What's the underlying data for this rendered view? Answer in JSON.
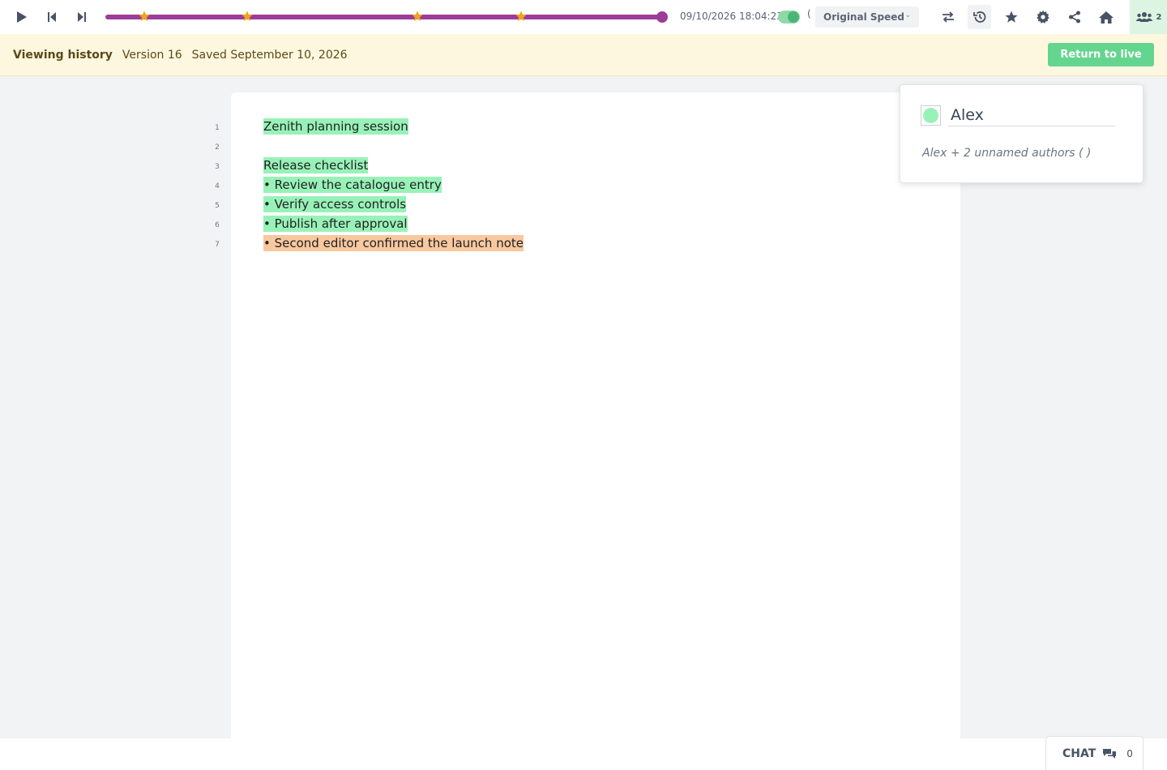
{
  "toolbar": {
    "timestamp": "09/10/2026 18:04:23",
    "speed_label": "Original Speed",
    "speed_glyph": "(",
    "timeline_progress": 1.0,
    "star_marks": [
      0.07,
      0.255,
      0.56,
      0.745
    ],
    "accent_color": "#9c3d99",
    "icons": [
      "play-icon",
      "step-back-icon",
      "step-forward-icon",
      "swap-icon",
      "history-icon",
      "star-icon",
      "gear-icon",
      "share-icon",
      "home-icon",
      "users-icon"
    ],
    "users_count": "2"
  },
  "banner": {
    "title": "Viewing history",
    "version": "Version 16",
    "saved": "Saved September 10, 2026",
    "return_label": "Return to live"
  },
  "editor": {
    "line_numbers": [
      "1",
      "2",
      "3",
      "4",
      "5",
      "6",
      "7"
    ],
    "lines": [
      {
        "text": "Zenith planning session",
        "author": "green"
      },
      {
        "text": "",
        "author": "none"
      },
      {
        "text": "Release checklist",
        "author": "green"
      },
      {
        "text": "• Review the catalogue entry",
        "author": "green"
      },
      {
        "text": "• Verify access controls",
        "author": "green"
      },
      {
        "text": "• Publish after approval",
        "author": "green"
      },
      {
        "text": "• Second editor confirmed the launch note",
        "author": "orange"
      }
    ],
    "author_colors": {
      "green": "#98f2b8",
      "orange": "#f8c89f"
    }
  },
  "users_popup": {
    "name": "Alex",
    "authors": "Alex + 2 unnamed authors (   )"
  },
  "chat": {
    "label": "CHAT",
    "count": "0"
  }
}
